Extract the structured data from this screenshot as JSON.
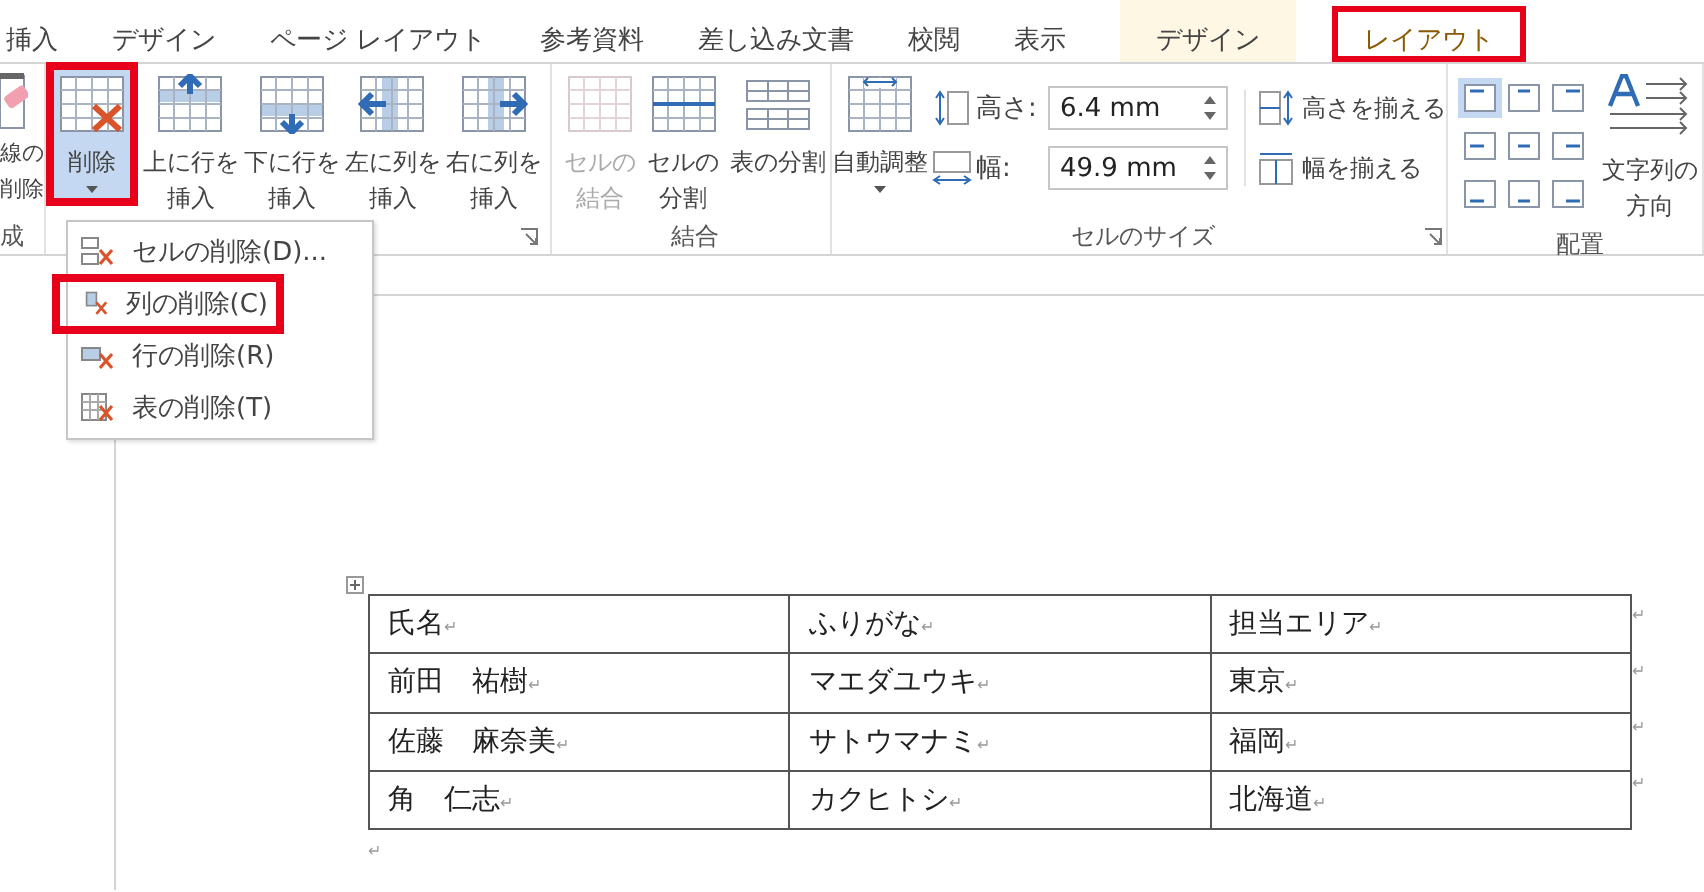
{
  "tabs": [
    {
      "label": "挿入",
      "selected": false,
      "contextual": false,
      "callout": false
    },
    {
      "label": "デザイン",
      "selected": false,
      "contextual": false,
      "callout": false
    },
    {
      "label": "ページ レイアウト",
      "selected": false,
      "contextual": false,
      "callout": false
    },
    {
      "label": "参考資料",
      "selected": false,
      "contextual": false,
      "callout": false
    },
    {
      "label": "差し込み文書",
      "selected": false,
      "contextual": false,
      "callout": false
    },
    {
      "label": "校閲",
      "selected": false,
      "contextual": false,
      "callout": false
    },
    {
      "label": "表示",
      "selected": false,
      "contextual": false,
      "callout": false
    },
    {
      "label": "デザイン",
      "selected": false,
      "contextual": true,
      "callout": false
    },
    {
      "label": "レイアウト",
      "selected": true,
      "contextual": true,
      "callout": true
    }
  ],
  "partial_group": {
    "button_lines": [
      "線の",
      "削除"
    ],
    "label": "成"
  },
  "rows_columns_group": {
    "launcher": true,
    "buttons": [
      {
        "kind": "delete",
        "lines": [
          "削除"
        ],
        "pressed": true,
        "callout": true,
        "dropdown": true,
        "disabled": false
      },
      {
        "kind": "insert_above",
        "lines": [
          "上に行を",
          "挿入"
        ],
        "pressed": false,
        "callout": false,
        "dropdown": false,
        "disabled": false
      },
      {
        "kind": "insert_below",
        "lines": [
          "下に行を",
          "挿入"
        ],
        "pressed": false,
        "callout": false,
        "dropdown": false,
        "disabled": false
      },
      {
        "kind": "insert_left",
        "lines": [
          "左に列を",
          "挿入"
        ],
        "pressed": false,
        "callout": false,
        "dropdown": false,
        "disabled": false
      },
      {
        "kind": "insert_right",
        "lines": [
          "右に列を",
          "挿入"
        ],
        "pressed": false,
        "callout": false,
        "dropdown": false,
        "disabled": false
      }
    ]
  },
  "merge_group": {
    "label": "結合",
    "buttons": [
      {
        "kind": "merge",
        "lines": [
          "セルの",
          "結合"
        ],
        "pressed": false,
        "callout": false,
        "dropdown": false,
        "disabled": true
      },
      {
        "kind": "split_cells",
        "lines": [
          "セルの",
          "分割"
        ],
        "pressed": false,
        "callout": false,
        "dropdown": false,
        "disabled": false
      },
      {
        "kind": "split_table",
        "lines": [
          "表の分割"
        ],
        "pressed": false,
        "callout": false,
        "dropdown": false,
        "disabled": false
      }
    ]
  },
  "cell_size_group": {
    "label": "セルのサイズ",
    "launcher": true,
    "autofit": {
      "kind": "autofit",
      "lines": [
        "自動調整"
      ],
      "pressed": false,
      "callout": false,
      "dropdown": true,
      "disabled": false
    },
    "height": {
      "label": "高さ:",
      "value": "6.4 mm"
    },
    "width": {
      "label": "幅:",
      "value": "49.9 mm"
    },
    "distribute": [
      {
        "kind": "rows",
        "label": "高さを揃える"
      },
      {
        "kind": "columns",
        "label": "幅を揃える"
      }
    ]
  },
  "alignment_group": {
    "label": "配置",
    "cells": [
      {
        "selected": true
      },
      {
        "selected": false
      },
      {
        "selected": false
      },
      {
        "selected": false
      },
      {
        "selected": false
      },
      {
        "selected": false
      },
      {
        "selected": false
      },
      {
        "selected": false
      },
      {
        "selected": false
      }
    ],
    "direction": {
      "lines": [
        "文字列の",
        "方向"
      ]
    }
  },
  "menu": {
    "items": [
      {
        "kind": "cells",
        "label": "セルの削除(D)...",
        "callout": false
      },
      {
        "kind": "columns",
        "label": "列の削除(C)",
        "callout": true
      },
      {
        "kind": "rows",
        "label": "行の削除(R)",
        "callout": false
      },
      {
        "kind": "table",
        "label": "表の削除(T)",
        "callout": false
      }
    ]
  },
  "paragraph_mark": "↵",
  "table": {
    "rows": [
      [
        "氏名",
        "ふりがな",
        "担当エリア"
      ],
      [
        "前田　祐樹",
        "マエダユウキ",
        "東京"
      ],
      [
        "佐藤　麻奈美",
        "サトウマナミ",
        "福岡"
      ],
      [
        "角　仁志",
        "カクヒトシ",
        "北海道"
      ]
    ]
  }
}
